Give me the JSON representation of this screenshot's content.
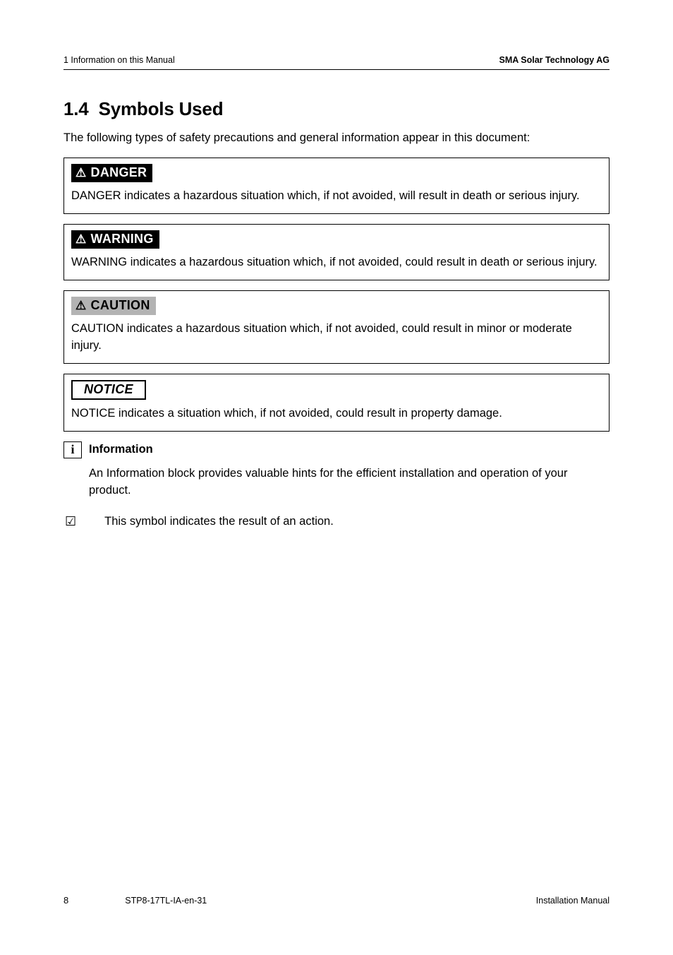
{
  "header": {
    "left": "1  Information on this Manual",
    "right": "SMA Solar Technology AG"
  },
  "section": {
    "number": "1.4",
    "title": "Symbols Used",
    "intro": "The following types of safety precautions and general information appear in this document:"
  },
  "callouts": {
    "danger": {
      "label": "DANGER",
      "body": "DANGER indicates a hazardous situation which, if not avoided, will result in death or serious injury."
    },
    "warning": {
      "label": "WARNING",
      "body": "WARNING indicates a hazardous situation which, if not avoided, could result in death or serious injury."
    },
    "caution": {
      "label": "CAUTION",
      "body": "CAUTION indicates a hazardous situation which, if not avoided, could result in minor or moderate injury."
    },
    "notice": {
      "label": "NOTICE",
      "body": "NOTICE indicates a situation which, if not avoided, could result in property damage."
    }
  },
  "info": {
    "title": "Information",
    "body": "An Information block provides valuable hints for the efficient installation and operation of your product."
  },
  "result": {
    "text": "This symbol indicates the result of an action."
  },
  "footer": {
    "page": "8",
    "doc_id": "STP8-17TL-IA-en-31",
    "doc_type": "Installation Manual"
  },
  "icons": {
    "triangle": "⚠",
    "info": "i",
    "check": "☑"
  }
}
